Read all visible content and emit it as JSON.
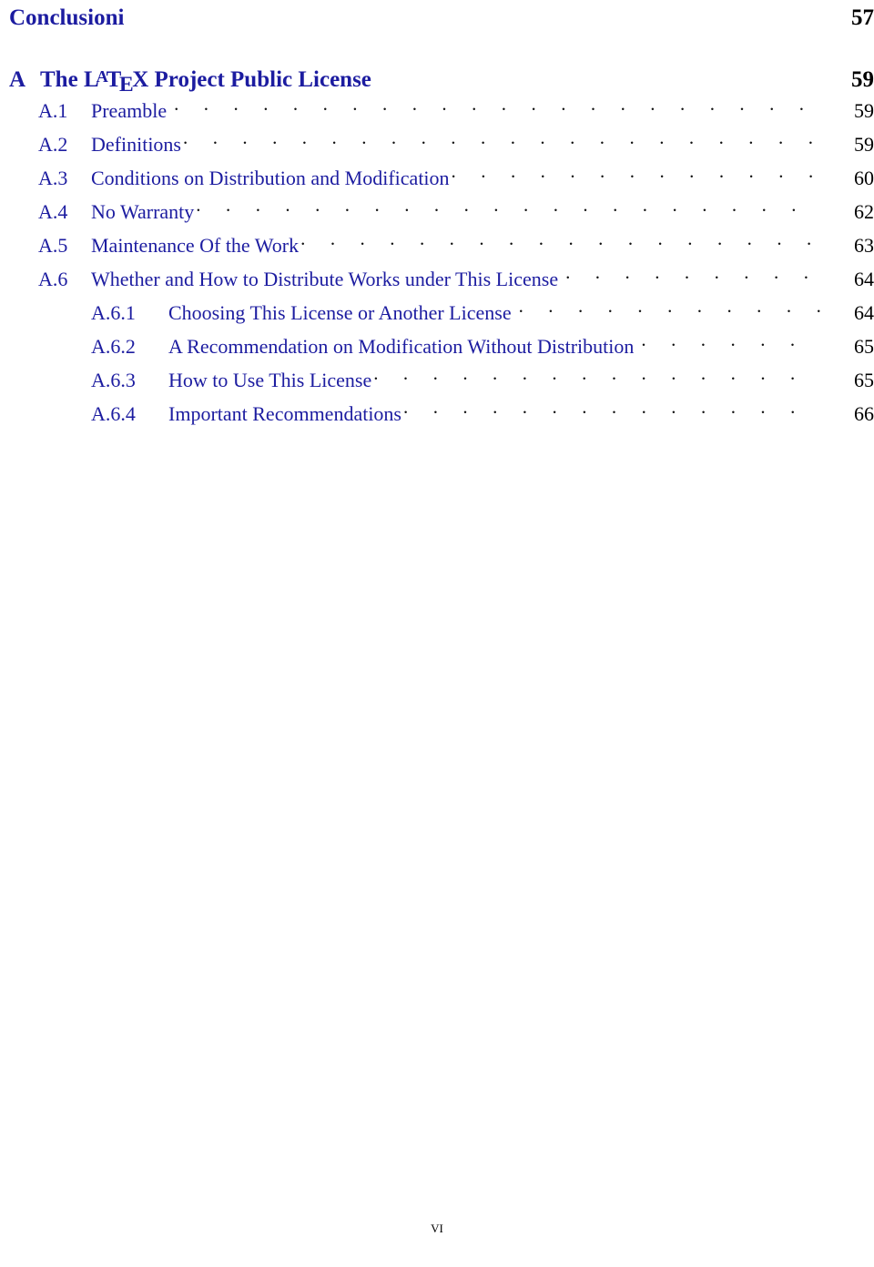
{
  "document": {
    "type": "table-of-contents",
    "text_color_entries": "#1c1ca0",
    "text_color_pagenumbers": "#000000",
    "background": "#ffffff"
  },
  "entries": [
    {
      "level": "chapter-plain",
      "number": "",
      "title": "Conclusioni",
      "page": "57",
      "leaders": false
    },
    {
      "level": "chapter",
      "number": "A",
      "title_prefix": "The ",
      "title_logo": "LaTeX",
      "title_suffix": " Project Public License",
      "title": "The LaTeX Project Public License",
      "page": "59",
      "leaders": false
    },
    {
      "level": "section",
      "number": "A.1",
      "title": "Preamble",
      "page": "59",
      "leaders": true
    },
    {
      "level": "section",
      "number": "A.2",
      "title": "Definitions",
      "page": "59",
      "leaders": true
    },
    {
      "level": "section",
      "number": "A.3",
      "title": "Conditions on Distribution and Modification",
      "page": "60",
      "leaders": true
    },
    {
      "level": "section",
      "number": "A.4",
      "title": "No Warranty",
      "page": "62",
      "leaders": true
    },
    {
      "level": "section",
      "number": "A.5",
      "title": "Maintenance Of the Work",
      "page": "63",
      "leaders": true
    },
    {
      "level": "section",
      "number": "A.6",
      "title": "Whether and How to Distribute Works under This License",
      "page": "64",
      "leaders": true
    },
    {
      "level": "subsection",
      "number": "A.6.1",
      "title": "Choosing This License or Another License",
      "page": "64",
      "leaders": true
    },
    {
      "level": "subsection",
      "number": "A.6.2",
      "title": "A Recommendation on Modification Without Distribution",
      "page": "65",
      "leaders": true
    },
    {
      "level": "subsection",
      "number": "A.6.3",
      "title": "How to Use This License",
      "page": "65",
      "leaders": true
    },
    {
      "level": "subsection",
      "number": "A.6.4",
      "title": "Important Recommendations",
      "page": "66",
      "leaders": true
    }
  ],
  "latex_logo": {
    "lead": "L",
    "raised_a": "A",
    "t": "T",
    "lowered_e": "E",
    "x": "X"
  },
  "footer": {
    "page_label": "vi"
  },
  "leader_dots": ". . . . . . . . . . . . . . . . . . . . . . . . . . . . . . . . . . . . . . . . . . . . . . . . . . . . . . . . . ."
}
